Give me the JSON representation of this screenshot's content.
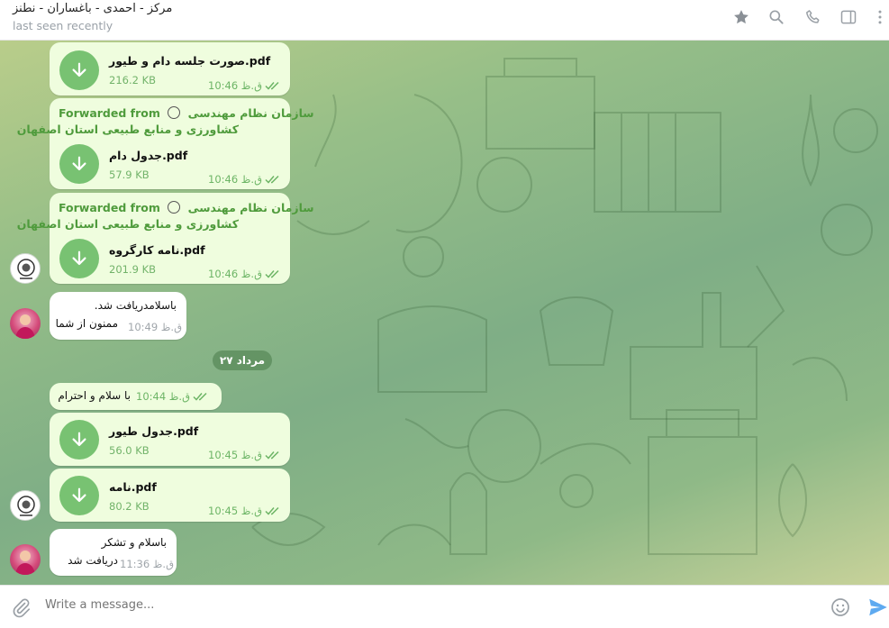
{
  "header": {
    "title": "مرکز - احمدی - باغساران - نطنز",
    "status": "last seen recently",
    "icons": [
      "star-icon",
      "search-icon",
      "phone-icon",
      "sidebar-toggle-icon",
      "more-icon"
    ]
  },
  "colors": {
    "outgoing_bubble": "#effdde",
    "incoming_bubble": "#ffffff",
    "download_button": "#78c272",
    "accent_green": "#4f9b3c",
    "send_icon": "#5eaaf0"
  },
  "messages": [
    {
      "type": "file",
      "direction": "out",
      "name": "صورت جلسه دام و طیور.pdf",
      "size": "216.2 KB",
      "time": "10:46 ق.ظ",
      "read": true
    },
    {
      "type": "file",
      "direction": "out",
      "forwarded_label": "Forwarded from",
      "forwarded_name_1": "سازمان نظام مهندسی",
      "forwarded_name_2": "کشاورزی و منابع طبیعی استان اصفهان",
      "name": "جدول دام.pdf",
      "size": "57.9 KB",
      "time": "10:46 ق.ظ",
      "read": true
    },
    {
      "type": "file",
      "direction": "out",
      "forwarded_label": "Forwarded from",
      "forwarded_name_1": "سازمان نظام مهندسی",
      "forwarded_name_2": "کشاورزی و منابع طبیعی استان اصفهان",
      "name": "نامه کارگروه.pdf",
      "size": "201.9 KB",
      "time": "10:46 ق.ظ",
      "read": true
    },
    {
      "type": "text",
      "direction": "in",
      "line1": "باسلامدریافت شد.",
      "line2": "ممنون از شما",
      "time": "10:49 ق.ظ"
    },
    {
      "type": "text",
      "direction": "out",
      "line1": "با سلام و احترام",
      "time": "10:44 ق.ظ",
      "read": true
    },
    {
      "type": "file",
      "direction": "out",
      "name": "جدول طیور.pdf",
      "size": "56.0 KB",
      "time": "10:45 ق.ظ",
      "read": true
    },
    {
      "type": "file",
      "direction": "out",
      "name": "نامه.pdf",
      "size": "80.2 KB",
      "time": "10:45 ق.ظ",
      "read": true
    },
    {
      "type": "text",
      "direction": "in",
      "line1": "باسلام و تشکر",
      "line2": "دریافت شد",
      "time": "11:36 ق.ظ"
    }
  ],
  "date_separator": "۲۷ مرداد",
  "composer": {
    "placeholder": "Write a message...",
    "icons": [
      "attach-icon",
      "emoji-icon",
      "send-icon"
    ]
  }
}
